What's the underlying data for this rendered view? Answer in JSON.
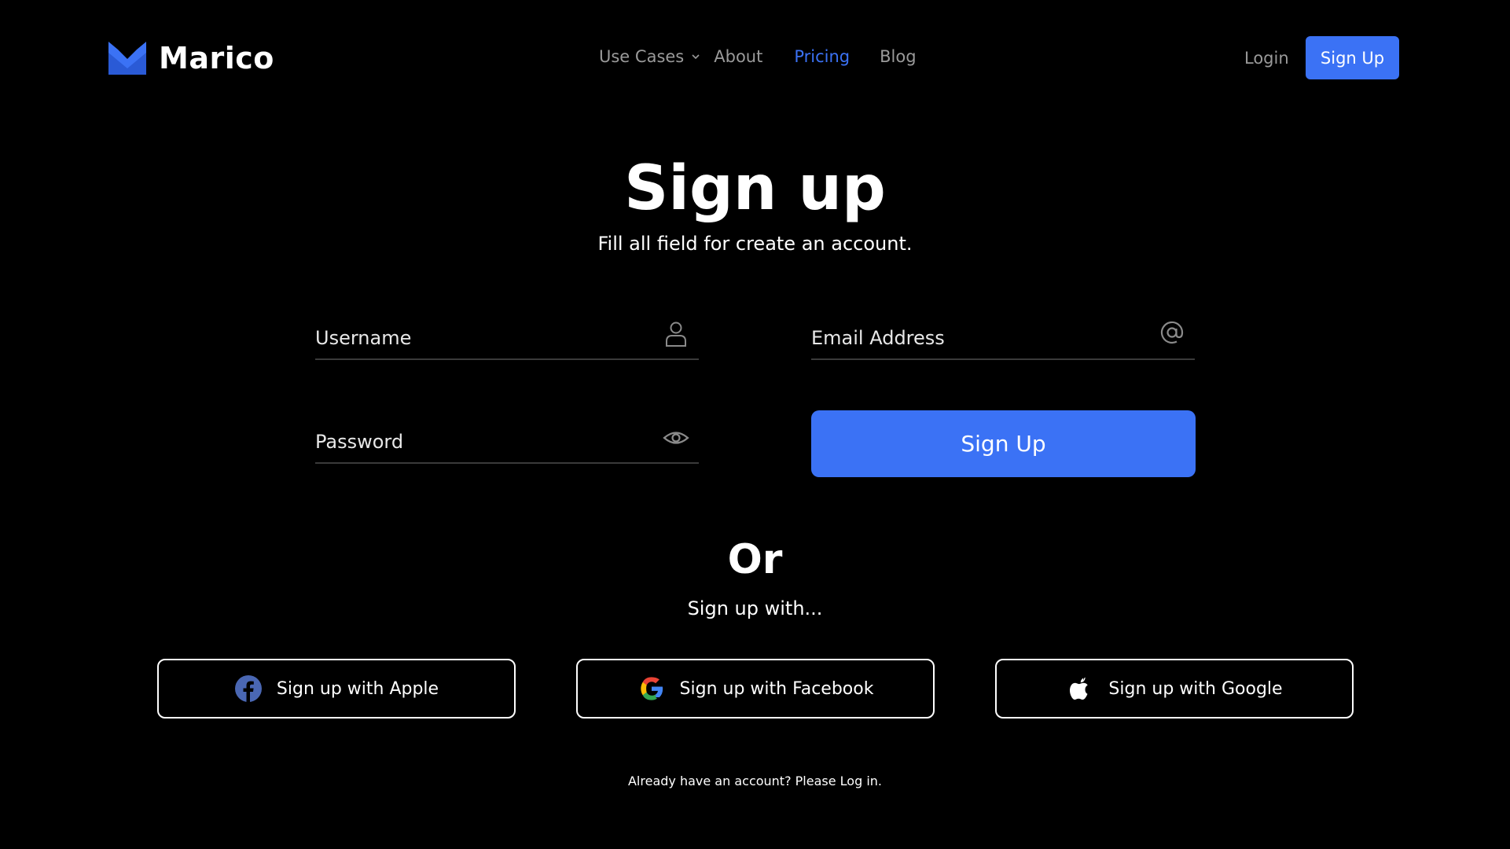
{
  "brand": {
    "name": "Marico",
    "logo_icon": "marico-m-logo",
    "accent_color": "#3b72f5"
  },
  "nav": {
    "items": [
      {
        "label": "Use Cases",
        "has_dropdown": true
      },
      {
        "label": "About"
      },
      {
        "label": "Pricing",
        "active": true
      },
      {
        "label": "Blog"
      }
    ],
    "login_label": "Login",
    "signup_label": "Sign Up"
  },
  "hero": {
    "title": "Sign up",
    "subtitle": "Fill all field for create an account."
  },
  "form": {
    "username_placeholder": "Username",
    "username_icon": "user-icon",
    "email_placeholder": "Email Address",
    "email_icon": "at-sign-icon",
    "password_placeholder": "Password",
    "password_icon": "eye-icon",
    "submit_label": "Sign Up"
  },
  "alt": {
    "or_label": "Or",
    "sub_label": "Sign up with...",
    "buttons": [
      {
        "label": "Sign up with Apple",
        "icon": "facebook-icon"
      },
      {
        "label": "Sign up with Facebook",
        "icon": "google-icon"
      },
      {
        "label": "Sign up with Google",
        "icon": "apple-icon"
      }
    ]
  },
  "footer": {
    "text": "Already have an account? Please Log in."
  }
}
